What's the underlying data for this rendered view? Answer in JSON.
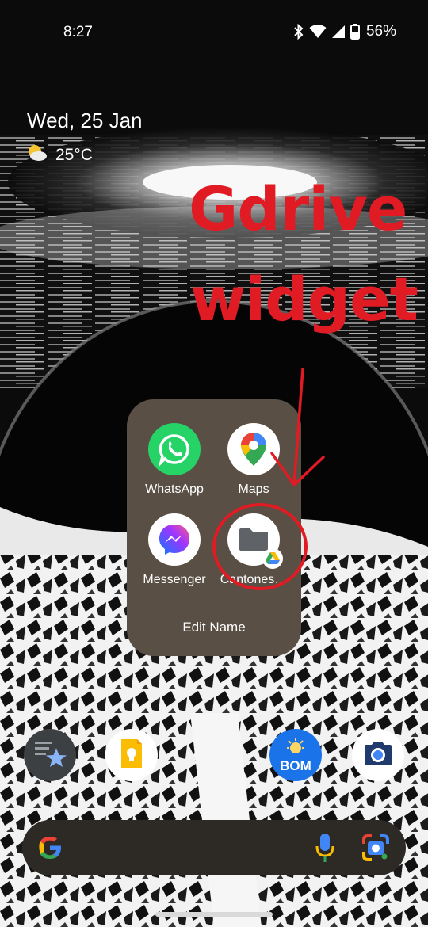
{
  "status_bar": {
    "time": "8:27",
    "battery_percent": "56%",
    "icons": [
      "bluetooth-icon",
      "wifi-icon",
      "cell-signal-icon",
      "battery-icon"
    ]
  },
  "at_a_glance": {
    "date": "Wed, 25 Jan",
    "weather_icon": "partly-cloudy-icon",
    "temperature": "25°C"
  },
  "annotation": {
    "line1": "Gdrive",
    "line2": "widget",
    "color": "#e01b24"
  },
  "folder": {
    "name": "Edit Name",
    "apps": [
      {
        "label": "WhatsApp",
        "icon": "whatsapp-icon"
      },
      {
        "label": "Maps",
        "icon": "maps-icon"
      },
      {
        "label": "Messenger",
        "icon": "messenger-icon"
      },
      {
        "label": "Cantones…",
        "icon": "drive-folder-shortcut-icon"
      }
    ]
  },
  "dock": [
    {
      "name": "starred-files-app",
      "icon": "star-doc-icon"
    },
    {
      "name": "keep-notes",
      "icon": "lightbulb-icon"
    },
    {
      "name": "bom-weather",
      "icon": "sun-icon",
      "text": "BOM"
    },
    {
      "name": "camera",
      "icon": "camera-icon"
    }
  ],
  "search_bar": {
    "icons": [
      "google-g-icon",
      "mic-icon",
      "lens-icon"
    ]
  }
}
